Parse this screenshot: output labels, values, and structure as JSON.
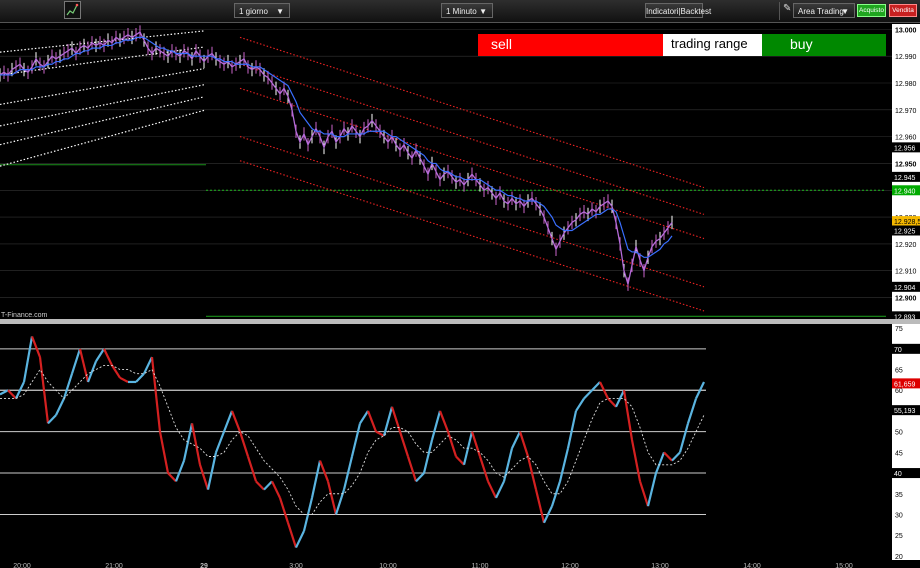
{
  "toolbar": {
    "period_select": "1 giorno",
    "interval_select": "1 Minuto",
    "indicators_button": "Indicatori|Backtest",
    "area_select": "Area Trading",
    "buy_button": "Acquisto",
    "sell_button": "Vendita"
  },
  "signal_bar": {
    "sell_label": "sell",
    "range_label": "trading range",
    "buy_label": "buy",
    "colors": {
      "sell": "#ff0000",
      "range": "#ffffff",
      "buy": "#008000"
    }
  },
  "watermark": "T-Finance.com",
  "top_axis": {
    "ticks": [
      "13.000",
      "12.990",
      "12.980",
      "12.970",
      "12.960",
      "12.950",
      "12.940",
      "12.930",
      "12.920",
      "12.910",
      "12.900"
    ],
    "level_boxes": [
      {
        "label": "12.956",
        "price": 12.956,
        "style": "dark"
      },
      {
        "label": "12.945",
        "price": 12.945,
        "style": "dark"
      },
      {
        "label": "12.940",
        "price": 12.94,
        "style": "green"
      },
      {
        "label": "12.928,5",
        "price": 12.9285,
        "style": "yellow"
      },
      {
        "label": "12.925",
        "price": 12.925,
        "style": "dark"
      },
      {
        "label": "12.904",
        "price": 12.904,
        "style": "dark"
      },
      {
        "label": "12.893",
        "price": 12.893,
        "style": "dark"
      }
    ]
  },
  "bottom_axis": {
    "ticks": [
      "75",
      "70",
      "65",
      "60",
      "55",
      "50",
      "45",
      "40",
      "35",
      "30",
      "25",
      "20"
    ],
    "level_boxes": [
      {
        "label": "70",
        "value": 70,
        "style": "dark"
      },
      {
        "label": "61,659",
        "value": 61.659,
        "style": "red"
      },
      {
        "label": "55,193",
        "value": 55.193,
        "style": "dark"
      },
      {
        "label": "40",
        "value": 40,
        "style": "dark"
      }
    ]
  },
  "time_axis": {
    "labels": [
      "20:00",
      "21:00",
      "29",
      "3:00",
      "10:00",
      "11:00",
      "12:00",
      "13:00",
      "14:00",
      "15:00"
    ]
  },
  "chart_data": [
    {
      "type": "line",
      "title": "",
      "ylim": [
        12.892,
        13.002
      ],
      "x": [
        0,
        4,
        8,
        12,
        16,
        20,
        24,
        28,
        32,
        36,
        40,
        44,
        48,
        52,
        56,
        60,
        64,
        68,
        72,
        76,
        80,
        84,
        88,
        92,
        96,
        100,
        104,
        108,
        112,
        116,
        120,
        124,
        128,
        132,
        136,
        140,
        144,
        148,
        152,
        156,
        160,
        164,
        168,
        172,
        176,
        180,
        184,
        188,
        192,
        196,
        200,
        204,
        208,
        212,
        216,
        220,
        224,
        228,
        232,
        236,
        240,
        244,
        248,
        252,
        256,
        260,
        264,
        268,
        272,
        276,
        280,
        284,
        288,
        292,
        296,
        300,
        304,
        308,
        312,
        316,
        320,
        324,
        328,
        332,
        336,
        340,
        344,
        348,
        352,
        356,
        360,
        364,
        368,
        372,
        376,
        380,
        384,
        388,
        392,
        396,
        400,
        404,
        408,
        412,
        416,
        420,
        424,
        428,
        432,
        436,
        440,
        444,
        448,
        452,
        456,
        460,
        464,
        468,
        472,
        476,
        480,
        484,
        488,
        492,
        496,
        500,
        504,
        508,
        512,
        516,
        520,
        524,
        528,
        532,
        536,
        540,
        544,
        548,
        552,
        556,
        560,
        564,
        568,
        572,
        576,
        580,
        584,
        588,
        592,
        596,
        600,
        604,
        608,
        612,
        616,
        620,
        624,
        628,
        632,
        636,
        640,
        644,
        648,
        652,
        656,
        660,
        664,
        668,
        672,
        676,
        680,
        684,
        688,
        692,
        696,
        700,
        704
      ],
      "series": [
        {
          "values": [
            12.983,
            12.984,
            12.983,
            12.985,
            12.986,
            12.987,
            12.985,
            12.984,
            12.986,
            12.989,
            12.987,
            12.986,
            12.988,
            12.99,
            12.989,
            12.99,
            12.991,
            12.992,
            12.993,
            12.991,
            12.993,
            12.994,
            12.993,
            12.995,
            12.994,
            12.995,
            12.994,
            12.996,
            12.995,
            12.997,
            12.996,
            12.997,
            12.998,
            12.997,
            12.998,
            12.999,
            12.996,
            12.993,
            12.991,
            12.993,
            12.992,
            12.991,
            12.99,
            12.992,
            12.991,
            12.99,
            12.992,
            12.991,
            12.989,
            12.992,
            12.99,
            12.988,
            12.99,
            12.991,
            12.989,
            12.988,
            12.987,
            12.988,
            12.986,
            12.987,
            12.988,
            12.989,
            12.986,
            12.985,
            12.986,
            12.985,
            12.983,
            12.982,
            12.98,
            12.978,
            12.976,
            12.978,
            12.975,
            12.97,
            12.962,
            12.958,
            12.961,
            12.957,
            12.96,
            12.963,
            12.96,
            12.956,
            12.96,
            12.962,
            12.958,
            12.96,
            12.963,
            12.961,
            12.964,
            12.962,
            12.96,
            12.963,
            12.964,
            12.966,
            12.964,
            12.962,
            12.96,
            12.958,
            12.96,
            12.957,
            12.955,
            12.957,
            12.954,
            12.952,
            12.955,
            12.952,
            12.949,
            12.946,
            12.95,
            12.947,
            12.944,
            12.946,
            12.947,
            12.945,
            12.943,
            12.944,
            12.942,
            12.944,
            12.946,
            12.944,
            12.942,
            12.94,
            12.941,
            12.939,
            12.937,
            12.939,
            12.936,
            12.935,
            12.937,
            12.935,
            12.936,
            12.934,
            12.936,
            12.937,
            12.935,
            12.933,
            12.93,
            12.926,
            12.922,
            12.918,
            12.921,
            12.924,
            12.926,
            12.928,
            12.929,
            12.931,
            12.932,
            12.931,
            12.933,
            12.932,
            12.934,
            12.935,
            12.936,
            12.934,
            12.928,
            12.92,
            12.91,
            12.905,
            12.912,
            12.919,
            12.914,
            12.91,
            12.915,
            12.919,
            12.921,
            12.922,
            12.924,
            12.926,
            12.928
          ]
        },
        {
          "values": [
            12.983,
            12.983,
            12.983,
            12.983,
            12.984,
            12.985,
            12.985,
            12.985,
            12.985,
            12.986,
            12.986,
            12.986,
            12.987,
            12.987,
            12.988,
            12.988,
            12.989,
            12.989,
            12.99,
            12.991,
            12.991,
            12.992,
            12.992,
            12.993,
            12.993,
            12.993,
            12.994,
            12.994,
            12.994,
            12.995,
            12.995,
            12.996,
            12.996,
            12.996,
            12.997,
            12.997,
            12.997,
            12.996,
            12.995,
            12.994,
            12.993,
            12.993,
            12.992,
            12.992,
            12.991,
            12.991,
            12.991,
            12.991,
            12.99,
            12.99,
            12.99,
            12.99,
            12.99,
            12.99,
            12.989,
            12.989,
            12.988,
            12.988,
            12.988,
            12.987,
            12.987,
            12.987,
            12.987,
            12.986,
            12.986,
            12.986,
            12.985,
            12.984,
            12.983,
            12.982,
            12.981,
            12.98,
            12.979,
            12.976,
            12.973,
            12.969,
            12.967,
            12.965,
            12.963,
            12.962,
            12.962,
            12.961,
            12.961,
            12.961,
            12.96,
            12.96,
            12.96,
            12.961,
            12.961,
            12.961,
            12.961,
            12.961,
            12.962,
            12.962,
            12.962,
            12.962,
            12.962,
            12.961,
            12.96,
            12.96,
            12.959,
            12.958,
            12.957,
            12.956,
            12.955,
            12.954,
            12.953,
            12.951,
            12.95,
            12.95,
            12.948,
            12.947,
            12.947,
            12.946,
            12.945,
            12.945,
            12.944,
            12.944,
            12.944,
            12.944,
            12.944,
            12.943,
            12.942,
            12.941,
            12.94,
            12.94,
            12.939,
            12.938,
            12.938,
            12.937,
            12.937,
            12.936,
            12.936,
            12.936,
            12.936,
            12.935,
            12.934,
            12.932,
            12.93,
            12.927,
            12.926,
            12.925,
            12.925,
            12.925,
            12.926,
            12.927,
            12.928,
            12.929,
            12.93,
            12.931,
            12.931,
            12.932,
            12.933,
            12.933,
            12.932,
            12.928,
            12.923,
            12.918,
            12.917,
            12.917,
            12.916,
            12.915,
            12.915,
            12.916,
            12.917,
            12.918,
            12.92,
            12.921,
            12.923
          ]
        }
      ]
    },
    {
      "type": "line",
      "title": "",
      "ylim": [
        19,
        76
      ],
      "x": [
        0,
        8,
        16,
        24,
        32,
        40,
        48,
        56,
        64,
        72,
        80,
        88,
        96,
        104,
        112,
        120,
        128,
        136,
        144,
        152,
        160,
        168,
        176,
        184,
        192,
        200,
        208,
        216,
        224,
        232,
        240,
        248,
        256,
        264,
        272,
        280,
        288,
        296,
        304,
        312,
        320,
        328,
        336,
        344,
        352,
        360,
        368,
        376,
        384,
        392,
        400,
        408,
        416,
        424,
        432,
        440,
        448,
        456,
        464,
        472,
        480,
        488,
        496,
        504,
        512,
        520,
        528,
        536,
        544,
        552,
        560,
        568,
        576,
        584,
        592,
        600,
        608,
        616,
        624,
        632,
        640,
        648,
        656,
        664,
        672,
        680,
        688,
        696,
        704
      ],
      "series": [
        {
          "values": [
            59,
            60,
            58,
            62,
            73,
            68,
            52,
            54,
            58,
            64,
            70,
            62,
            67,
            70,
            66,
            63,
            62,
            62,
            64,
            68,
            50,
            40,
            38,
            43,
            52,
            42,
            36,
            45,
            50,
            55,
            50,
            44,
            38,
            36,
            38,
            34,
            28,
            22,
            26,
            34,
            43,
            38,
            30,
            36,
            44,
            52,
            55,
            50,
            49,
            56,
            50,
            44,
            38,
            40,
            48,
            55,
            50,
            44,
            42,
            50,
            44,
            38,
            34,
            38,
            46,
            50,
            44,
            36,
            28,
            32,
            38,
            46,
            55,
            58,
            60,
            62,
            58,
            56,
            60,
            48,
            38,
            32,
            40,
            45,
            43,
            45,
            52,
            58,
            62
          ]
        },
        {
          "values": [
            58,
            58,
            58,
            59,
            62,
            65,
            62,
            60,
            58,
            60,
            62,
            64,
            65,
            66,
            66,
            65,
            65,
            64,
            64,
            65,
            61,
            56,
            51,
            48,
            47,
            46,
            44,
            44,
            45,
            48,
            50,
            49,
            46,
            43,
            41,
            39,
            36,
            32,
            30,
            30,
            33,
            35,
            35,
            35,
            37,
            40,
            45,
            48,
            49,
            51,
            51,
            50,
            47,
            45,
            45,
            47,
            49,
            48,
            46,
            46,
            45,
            43,
            40,
            39,
            41,
            43,
            44,
            42,
            38,
            35,
            35,
            38,
            43,
            48,
            53,
            57,
            58,
            58,
            58,
            56,
            51,
            45,
            42,
            42,
            42,
            43,
            46,
            50,
            54
          ]
        }
      ]
    }
  ]
}
